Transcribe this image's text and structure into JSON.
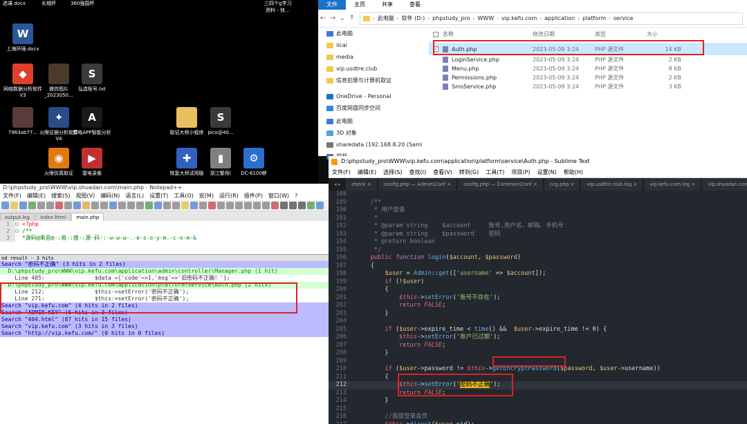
{
  "desktop": {
    "top_labels": [
      "选课.docx",
      "长城杯",
      "360强国杯",
      "三四个g学习",
      "资料 - 快..."
    ],
    "icons": [
      {
        "label": "上海环境.docx",
        "icon": "word-doc-icon",
        "color": "#2b579a",
        "glyph": "W"
      },
      {
        "label": "微信图片_2023050...",
        "icon": "image-file-icon",
        "color": "#4a3a2a",
        "glyph": ""
      },
      {
        "label": "弘连账号.txt",
        "icon": "sublime-file-icon",
        "color": "#3a3a3a",
        "glyph": "S"
      },
      {
        "label": "网络数据分析软件V3",
        "icon": "app-icon",
        "color": "#e0402a",
        "glyph": "◆"
      },
      {
        "label": "7963ab77...",
        "icon": "image-file-icon",
        "color": "#5a3a3a",
        "glyph": ""
      },
      {
        "label": "火眼证据分析软件V4",
        "icon": "app-icon",
        "color": "#2a4a8a",
        "glyph": "✦"
      },
      {
        "label": "雷电APP智能分析",
        "icon": "app-icon",
        "color": "#1a1a1a",
        "glyph": "A"
      },
      {
        "label": "取证大师小程序",
        "icon": "folder-icon",
        "color": "#e8c060",
        "glyph": ""
      },
      {
        "label": "pico@40...",
        "icon": "sublime-file-icon",
        "color": "#3a3a3a",
        "glyph": "S"
      },
      {
        "label": "火眼仿真取证",
        "icon": "app-icon",
        "color": "#e07a10",
        "glyph": "◉"
      },
      {
        "label": "雷电录像",
        "icon": "app-icon",
        "color": "#c03030",
        "glyph": "▶"
      },
      {
        "label": "恢复大师试用版",
        "icon": "app-icon",
        "color": "#3060c0",
        "glyph": "✚"
      },
      {
        "label": "浙江警用(",
        "icon": "app-icon",
        "color": "#808080",
        "glyph": "▮"
      },
      {
        "label": "DC-6100移",
        "icon": "app-icon",
        "color": "#2a70d0",
        "glyph": "⚙"
      }
    ]
  },
  "explorer": {
    "ribbon_tabs": [
      "文件",
      "主页",
      "共享",
      "查看"
    ],
    "breadcrumb": [
      "此电脑",
      "软件 (D:)",
      "phpstudy_pro",
      "WWW",
      "vip.kefu.com",
      "application",
      "platform",
      "service"
    ],
    "nav_items": [
      {
        "label": "此电脑",
        "icon": "pc-icon",
        "color": "#3a7bd5"
      },
      {
        "label": "licai",
        "icon": "folder-icon",
        "color": "#f4c84a"
      },
      {
        "label": "media",
        "icon": "folder-icon",
        "color": "#f4c84a"
      },
      {
        "label": "vip.usdtre.club",
        "icon": "folder-icon",
        "color": "#f4c84a"
      },
      {
        "label": "信息犯罪与计算机取证",
        "icon": "folder-icon",
        "color": "#f4c84a"
      },
      {
        "label": "OneDrive - Personal",
        "icon": "cloud-icon",
        "color": "#1a73c8"
      },
      {
        "label": "百度网盘同步空间",
        "icon": "cloud-icon",
        "color": "#2a8ae8"
      },
      {
        "label": "此电脑",
        "icon": "pc-icon",
        "color": "#3a7bd5"
      },
      {
        "label": "3D 对象",
        "icon": "cube-icon",
        "color": "#4aa3df"
      },
      {
        "label": "sharedata (192.168.8.20 (Samba ...",
        "icon": "network-drive-icon",
        "color": "#777777"
      },
      {
        "label": "视频",
        "icon": "video-icon",
        "color": "#5a6aa0"
      }
    ],
    "columns": {
      "name": "名称",
      "date": "修改日期",
      "type": "类型",
      "size": "大小"
    },
    "files": [
      {
        "name": "Auth.php",
        "date": "2023-05-09 3:24",
        "type": "PHP 源文件",
        "size": "14 KB",
        "selected": true
      },
      {
        "name": "LoginService.php",
        "date": "2023-05-09 3:24",
        "type": "PHP 源文件",
        "size": "2 KB",
        "selected": false
      },
      {
        "name": "Menu.php",
        "date": "2023-05-09 3:24",
        "type": "PHP 源文件",
        "size": "8 KB",
        "selected": false
      },
      {
        "name": "Permissions.php",
        "date": "2023-05-09 3:24",
        "type": "PHP 源文件",
        "size": "2 KB",
        "selected": false
      },
      {
        "name": "SmsService.php",
        "date": "2023-05-09 3:24",
        "type": "PHP 源文件",
        "size": "3 KB",
        "selected": false
      }
    ]
  },
  "notepad": {
    "title": "D:\\phpstudy_pro\\WWW\\vip.shuadan.com\\main.php - Notepad++",
    "menu": [
      "文件(F)",
      "编辑(E)",
      "搜索(S)",
      "视图(V)",
      "编码(N)",
      "语言(L)",
      "设置(T)",
      "工具(O)",
      "宏(M)",
      "运行(R)",
      "插件(P)",
      "窗口(W)",
      "?"
    ],
    "tabs": [
      "output.log",
      "index.html",
      "main.php"
    ],
    "code_lines": [
      {
        "num": "1",
        "text": "<?php"
      },
      {
        "num": "2",
        "text": "/**"
      },
      {
        "num": "3",
        "text": " *源码@来自@·:易·:搜·:源·码·:-w-w-w-.-e-s-o-y-m.-c-o-m-&"
      }
    ],
    "find_header": "nd result - 3 hits",
    "results": [
      {
        "kind": "search",
        "text": "Search \"密码不正确\" (3 hits in 2 files)"
      },
      {
        "kind": "file",
        "text": "  D:\\phpstudy_pro\\WWW\\vip.kefu.com\\application\\admin\\controller\\Manager.php (1 hit)"
      },
      {
        "kind": "line",
        "text": "    Line 485:               $data =['code'=>1,'msg'=>'旧密码不正确！'];"
      },
      {
        "kind": "file",
        "text": "  D:\\phpstudy_pro\\WWW\\vip.kefu.com\\application\\platform\\service\\Auth.php (2 hits)"
      },
      {
        "kind": "line",
        "text": "    Line 212:               $this->setError('密码不正确');"
      },
      {
        "kind": "line",
        "text": "    Line 271:               $this->setError('密码不正确');"
      },
      {
        "kind": "search",
        "text": "Search \"vip.kefu.com\" (4 hits in 2 files)"
      },
      {
        "kind": "search",
        "text": "Search \"ADMIN KEY\" (6 hits in 3 files)"
      },
      {
        "kind": "search",
        "text": "Search \"404.html\" (87 hits in 15 files)"
      },
      {
        "kind": "search",
        "text": "Search \"vip.kefu.com\" (3 hits in 3 files)"
      },
      {
        "kind": "search",
        "text": "Search \"http://vip.kefu.com/\" (0 hits in 0 files)"
      }
    ]
  },
  "sublime": {
    "title": "D:\\phpstudy_pro\\WWW\\vip.kefu.com\\application\\platform\\service\\Auth.php - Sublime Text",
    "menu": [
      "文件(F)",
      "编辑(E)",
      "选择(S)",
      "查找(I)",
      "查看(V)",
      "转到(G)",
      "工具(T)",
      "项目(P)",
      "设置(N)",
      "帮助(H)"
    ],
    "tabs": [
      "check",
      "config.php — Admin\\Conf",
      "config.php — Common\\Conf",
      "ccg.php",
      "vip.usdtre.club.log",
      "vip.kefu.com.log",
      "vip.shuadan.com"
    ],
    "current_line": "212"
  }
}
